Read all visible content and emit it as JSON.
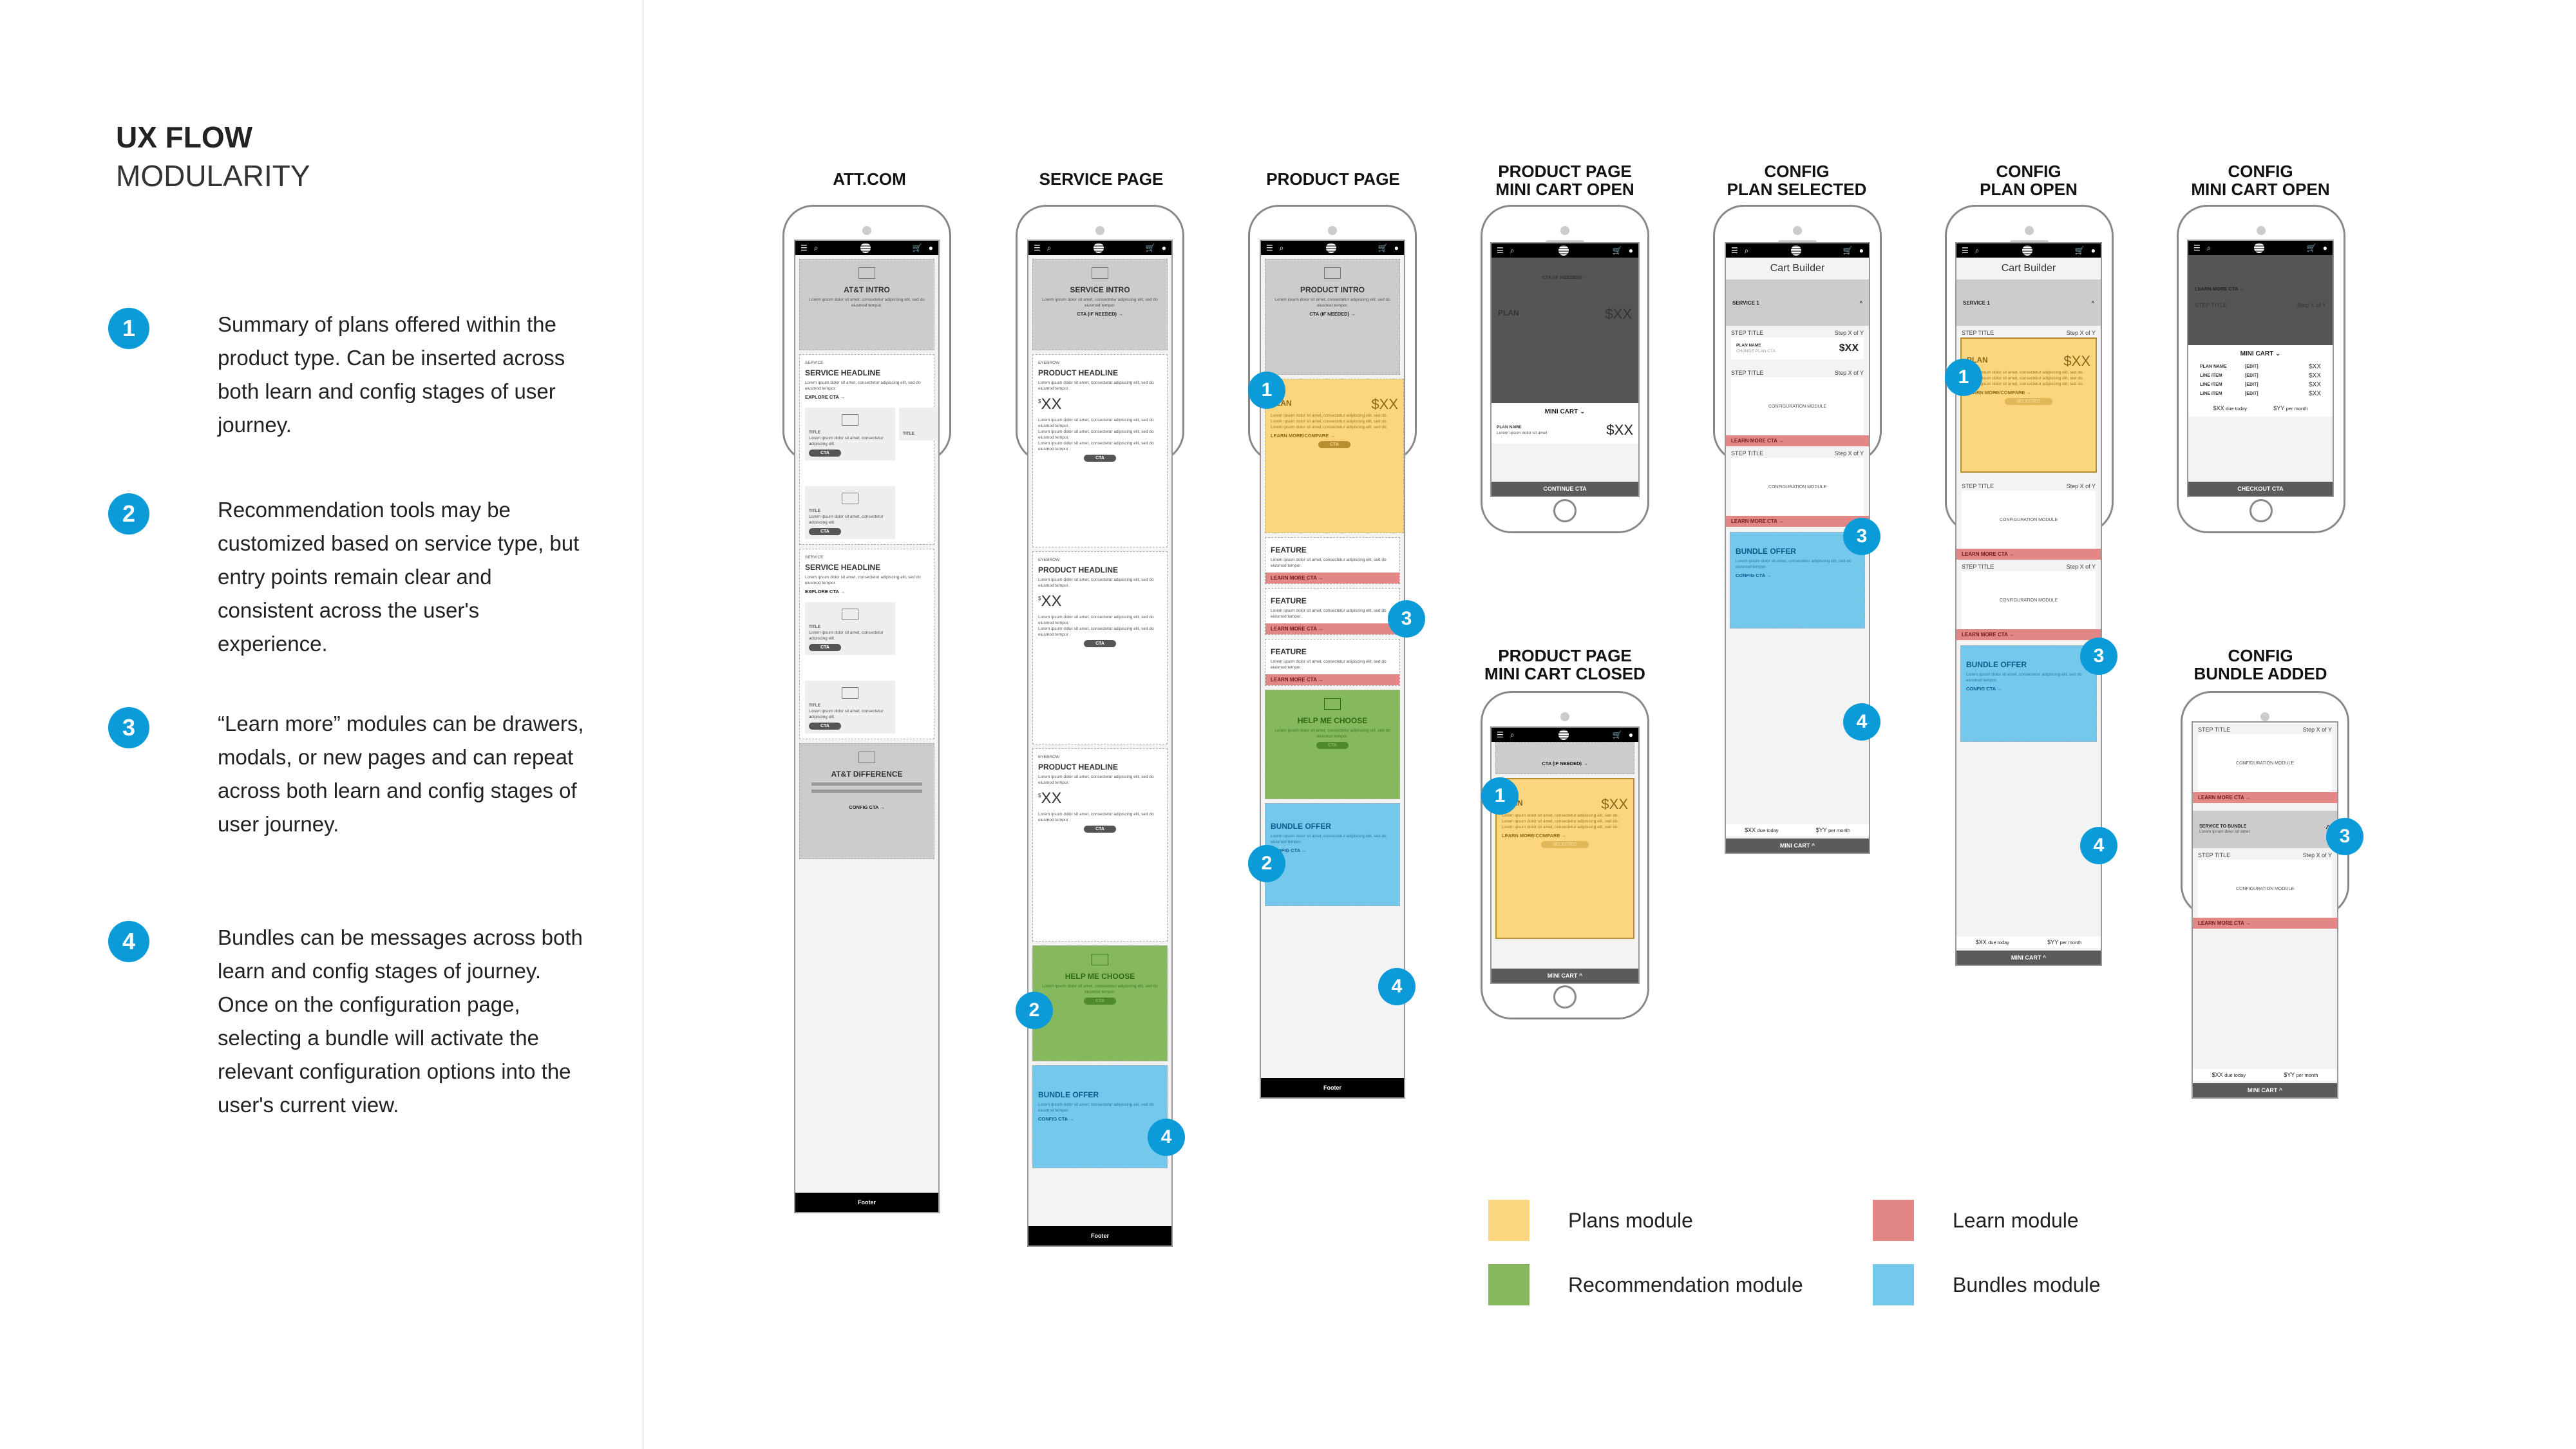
{
  "header": {
    "title": "UX FLOW",
    "subtitle": "MODULARITY"
  },
  "notes": [
    {
      "num": "1",
      "text": "Summary of plans offered within the product type. Can be inserted across both learn and config stages of user journey."
    },
    {
      "num": "2",
      "text": "Recommendation tools may be customized based on service type, but entry points remain clear and consistent across the user's experience."
    },
    {
      "num": "3",
      "text": "“Learn more” modules can be drawers, modals, or new pages and can repeat across both learn and config stages of user journey."
    },
    {
      "num": "4",
      "text": "Bundles can be messages across both learn and config stages of journey. Once on the configuration page, selecting a bundle will activate the relevant configuration options into the user's current view."
    }
  ],
  "columns": {
    "att": "ATT.COM",
    "service": "SERVICE PAGE",
    "product": "PRODUCT PAGE",
    "mini_open": "PRODUCT PAGE\nMINI CART OPEN",
    "mini_closed": "PRODUCT PAGE\nMINI CART CLOSED",
    "plan_selected": "CONFIG\nPLAN SELECTED",
    "plan_open": "CONFIG\nPLAN OPEN",
    "config_cart": "CONFIG\nMINI CART OPEN",
    "bundle_added": "CONFIG\nBUNDLE ADDED"
  },
  "wire": {
    "att_intro": "AT&T INTRO",
    "service_intro": "SERVICE INTRO",
    "product_intro": "PRODUCT INTRO",
    "lorem": "Lorem ipsum dolor sit amet, consectetur adipiscing elit, sed do eiusmod tempor.",
    "lorem_short": "Lorem ipsum dolor sit amet, consectetur adipiscing elit.",
    "lorem_plan": "Lorem ipsum dolor sit amet, consectetur adipiscing elit, sed do.",
    "lorem_tiny": "Lorem ipsum dolor sit amet",
    "cta_if_needed": "CTA (IF NEEDED) →",
    "service_eyebrow": "SERVICE",
    "service_headline": "SERVICE HEADLINE",
    "explore_cta": "EXPLORE CTA →",
    "title": "TITLE",
    "cta": "CTA",
    "att_difference": "AT&T DIFFERENCE",
    "config_cta": "CONFIG CTA →",
    "footer": "Footer",
    "eyebrow": "EYEBROW",
    "product_headline": "PRODUCT HEADLINE",
    "price": "$XX",
    "price_sup": "$",
    "price_val": "XX",
    "help_me_choose": "HELP ME CHOOSE",
    "bundle_offer": "BUNDLE OFFER",
    "plan": "PLAN",
    "learn_compare": "LEARN MORE/COMPARE →",
    "feature": "FEATURE",
    "learn_more_cta": "LEARN MORE CTA →",
    "mini_cart": "MINI CART",
    "plan_name": "PLAN NAME",
    "continue_cta": "CONTINUE CTA",
    "selected": "SELECTED",
    "cart_builder": "Cart Builder",
    "service1": "SERVICE 1",
    "step_title": "STEP TITLE",
    "step_xy": "Step X of Y",
    "change_plan": "CHANGE PLAN CTA",
    "config_module": "CONFIGURATION MODULE",
    "due_today_val": "$XX",
    "due_today": "due today",
    "per_month_val": "$YY",
    "per_month": "per month",
    "line_item": "LINE ITEM",
    "edit": "[EDIT]",
    "checkout_cta": "CHECKOUT CTA",
    "service_to_bundle": "SERVICE TO BUNDLE"
  },
  "legend": [
    {
      "label": "Plans module",
      "color": "#fcd67e"
    },
    {
      "label": "Learn module",
      "color": "#e28686"
    },
    {
      "label": "Recommendation module",
      "color": "#86b95e"
    },
    {
      "label": "Bundles module",
      "color": "#73c8ec"
    }
  ]
}
